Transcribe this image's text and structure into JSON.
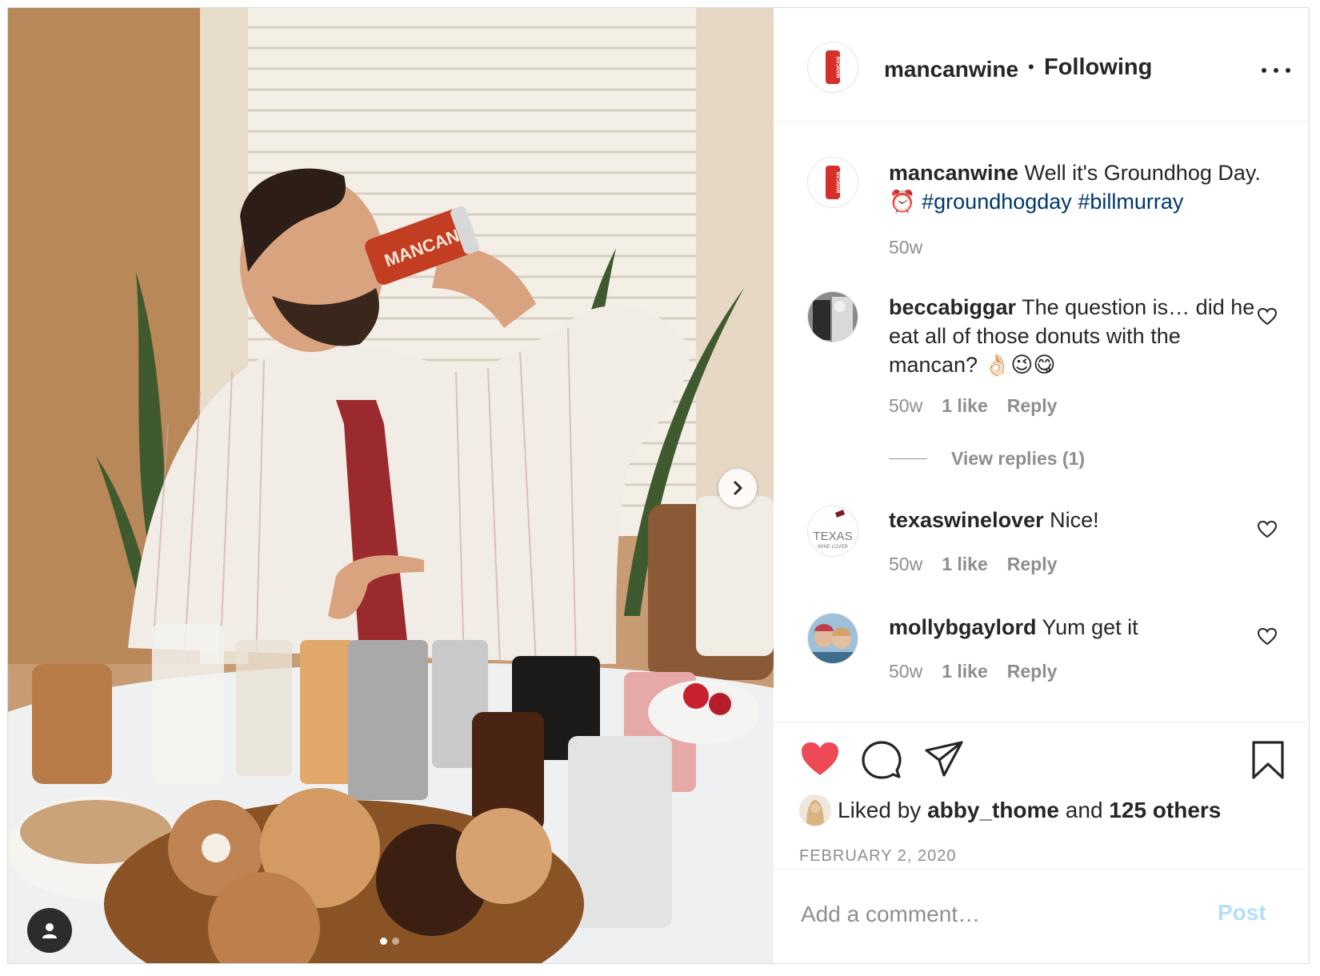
{
  "post": {
    "author": {
      "username": "mancanwine",
      "follow_state": "Following",
      "separator": "•",
      "avatar_text": "MANCAN"
    },
    "caption": {
      "username": "mancanwine",
      "text": "Well it's Groundhog Day.",
      "emoji": "⏰",
      "hashtags": [
        "#groundhogday",
        "#billmurray"
      ],
      "time": "50w"
    },
    "comments": [
      {
        "username": "beccabiggar",
        "text": "The question is… did he eat all of those donuts with the mancan? 👌🏻😉😋",
        "time": "50w",
        "likes": "1 like",
        "reply_label": "Reply",
        "view_replies": "View replies (1)"
      },
      {
        "username": "texaswinelover",
        "text": "Nice!",
        "time": "50w",
        "likes": "1 like",
        "reply_label": "Reply",
        "avatar_text": "TEXAS",
        "avatar_subtext": "WINE LOVER"
      },
      {
        "username": "mollybgaylord",
        "text": "Yum get it",
        "time": "50w",
        "likes": "1 like",
        "reply_label": "Reply"
      }
    ],
    "likes": {
      "prefix": "Liked by",
      "first_user": "abby_thome",
      "joiner": "and",
      "others": "125 others"
    },
    "date": "FEBRUARY 2, 2020",
    "add_comment": {
      "placeholder": "Add a comment…",
      "post_label": "Post"
    },
    "photo": {
      "can_text": "MANCAN",
      "carousel_count": 2,
      "carousel_active": 1
    },
    "colors": {
      "heart_liked": "#ed4956",
      "hashtag": "#00376b",
      "post_button_disabled": "#b2dffc",
      "muted_text": "#8e8e8e"
    },
    "icons": {
      "like": "heart-icon",
      "comment": "comment-icon",
      "share": "paper-plane-icon",
      "save": "bookmark-icon",
      "more": "more-options-icon",
      "next": "chevron-right-icon",
      "tags": "user-tag-icon"
    }
  }
}
